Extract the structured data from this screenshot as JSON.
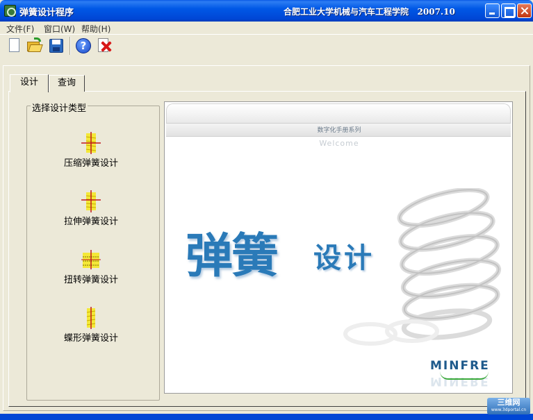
{
  "window": {
    "title": "弹簧设计程序",
    "info": "合肥工业大学机械与汽车工程学院   2007.10"
  },
  "menu": [
    "文件(F)",
    "窗口(W)",
    "帮助(H)"
  ],
  "toolbar": {
    "icons": [
      "new-file-icon",
      "open-folder-icon",
      "save-icon",
      "help-icon",
      "exit-icon"
    ],
    "help_glyph": "?"
  },
  "tabs": [
    "设计",
    "查询"
  ],
  "design_type": {
    "title": "选择设计类型",
    "items": [
      {
        "label": "压缩弹簧设计",
        "icon": "compression-spring-icon"
      },
      {
        "label": "拉伸弹簧设计",
        "icon": "extension-spring-icon"
      },
      {
        "label": "扭转弹簧设计",
        "icon": "torsion-spring-icon"
      },
      {
        "label": "蝶形弹簧设计",
        "icon": "disc-spring-icon"
      }
    ]
  },
  "welcome": {
    "series": "数字化手册系列",
    "greeting": "Welcome",
    "title": "弹簧",
    "subtitle": "设计",
    "brand": "MINFRE"
  },
  "watermark": {
    "text": "三维网",
    "url": "www.3dportal.cn"
  },
  "colors": {
    "titlebar": "#0058e6",
    "welcome_text": "#2a7ab8",
    "window_bg": "#ece9d8"
  }
}
